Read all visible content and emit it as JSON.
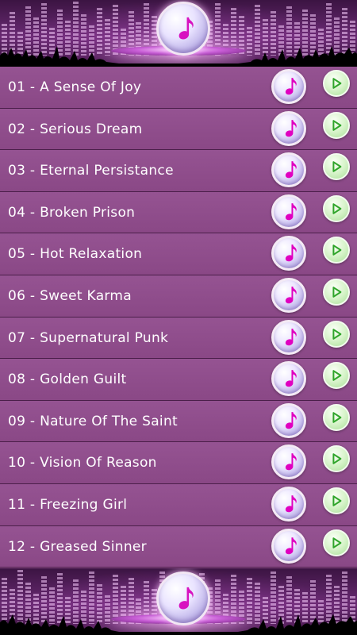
{
  "colors": {
    "row_background": "#8c4b88",
    "row_divider": "#4a1e49",
    "text": "#ffffff",
    "note_glyph": "#e000c0",
    "play_glyph": "#2fa52a",
    "banner_glow": "#ffc8ff"
  },
  "header": {
    "logo_icon": "music-note-icon"
  },
  "footer": {
    "logo_icon": "music-note-icon"
  },
  "tracks": [
    {
      "title": "01 - A Sense Of Joy"
    },
    {
      "title": "02 - Serious Dream"
    },
    {
      "title": "03 - Eternal Persistance"
    },
    {
      "title": "04 - Broken Prison"
    },
    {
      "title": "05 - Hot Relaxation"
    },
    {
      "title": "06 - Sweet Karma"
    },
    {
      "title": "07 - Supernatural Punk"
    },
    {
      "title": "08 - Golden Guilt"
    },
    {
      "title": "09 - Nature Of The Saint"
    },
    {
      "title": "10 - Vision Of Reason"
    },
    {
      "title": "11 - Freezing Girl"
    },
    {
      "title": "12 - Greased Sinner"
    }
  ],
  "row_icons": {
    "ringtone": "music-note-icon",
    "play": "play-icon"
  }
}
